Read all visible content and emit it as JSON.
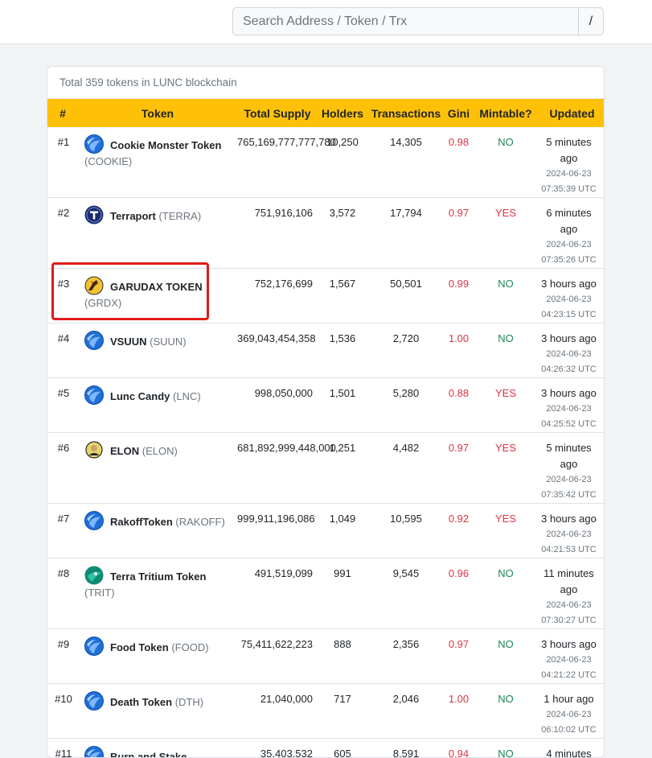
{
  "search": {
    "placeholder": "Search Address / Token / Trx",
    "shortcut_key": "/"
  },
  "card": {
    "title": "Total 359 tokens in LUNC blockchain"
  },
  "table": {
    "headers": [
      "#",
      "Token",
      "Total Supply",
      "Holders",
      "Transactions",
      "Gini",
      "Mintable?",
      "Updated"
    ],
    "rows": [
      {
        "rank": "#1",
        "name": "Cookie Monster Token",
        "symbol": "(COOKIE)",
        "icon": "terra-luna-icon",
        "supply": "765,169,777,777,780",
        "holders": "10,250",
        "transactions": "14,305",
        "gini": "0.98",
        "mintable": "NO",
        "ago": "5 minutes ago",
        "timestamp": "2024-06-23 07:35:39 UTC"
      },
      {
        "rank": "#2",
        "name": "Terraport",
        "symbol": "(TERRA)",
        "icon": "terraport-icon",
        "supply": "751,916,106",
        "holders": "3,572",
        "transactions": "17,794",
        "gini": "0.97",
        "mintable": "YES",
        "ago": "6 minutes ago",
        "timestamp": "2024-06-23 07:35:26 UTC"
      },
      {
        "rank": "#3",
        "name": "GARUDAX TOKEN",
        "symbol": "(GRDX)",
        "icon": "garudax-icon",
        "supply": "752,176,699",
        "holders": "1,567",
        "transactions": "50,501",
        "gini": "0.99",
        "mintable": "NO",
        "ago": "3 hours ago",
        "timestamp": "2024-06-23 04:23:15 UTC"
      },
      {
        "rank": "#4",
        "name": "VSUUN",
        "symbol": "(SUUN)",
        "icon": "terra-luna-icon",
        "supply": "369,043,454,358",
        "holders": "1,536",
        "transactions": "2,720",
        "gini": "1.00",
        "mintable": "NO",
        "ago": "3 hours ago",
        "timestamp": "2024-06-23 04:26:32 UTC"
      },
      {
        "rank": "#5",
        "name": "Lunc Candy",
        "symbol": "(LNC)",
        "icon": "terra-luna-icon",
        "supply": "998,050,000",
        "holders": "1,501",
        "transactions": "5,280",
        "gini": "0.88",
        "mintable": "YES",
        "ago": "3 hours ago",
        "timestamp": "2024-06-23 04:25:52 UTC"
      },
      {
        "rank": "#6",
        "name": "ELON",
        "symbol": "(ELON)",
        "icon": "elon-face-icon",
        "supply": "681,892,999,448,000",
        "holders": "1,251",
        "transactions": "4,482",
        "gini": "0.97",
        "mintable": "YES",
        "ago": "5 minutes ago",
        "timestamp": "2024-06-23 07:35:42 UTC"
      },
      {
        "rank": "#7",
        "name": "RakoffToken",
        "symbol": "(RAKOFF)",
        "icon": "terra-luna-icon",
        "supply": "999,911,196,086",
        "holders": "1,049",
        "transactions": "10,595",
        "gini": "0.92",
        "mintable": "YES",
        "ago": "3 hours ago",
        "timestamp": "2024-06-23 04:21:53 UTC"
      },
      {
        "rank": "#8",
        "name": "Terra Tritium Token",
        "symbol": "(TRIT)",
        "icon": "tritium-icon",
        "supply": "491,519,099",
        "holders": "991",
        "transactions": "9,545",
        "gini": "0.96",
        "mintable": "NO",
        "ago": "11 minutes ago",
        "timestamp": "2024-06-23 07:30:27 UTC"
      },
      {
        "rank": "#9",
        "name": "Food Token",
        "symbol": "(FOOD)",
        "icon": "terra-luna-icon",
        "supply": "75,411,622,223",
        "holders": "888",
        "transactions": "2,356",
        "gini": "0.97",
        "mintable": "NO",
        "ago": "3 hours ago",
        "timestamp": "2024-06-23 04:21:22 UTC"
      },
      {
        "rank": "#10",
        "name": "Death Token",
        "symbol": "(DTH)",
        "icon": "terra-luna-icon",
        "supply": "21,040,000",
        "holders": "717",
        "transactions": "2,046",
        "gini": "1.00",
        "mintable": "NO",
        "ago": "1 hour ago",
        "timestamp": "2024-06-23 06:10:02 UTC"
      },
      {
        "rank": "#11",
        "name": "Burn and Stake",
        "symbol": "",
        "icon": "terra-luna-icon",
        "supply": "35,403,532",
        "holders": "605",
        "transactions": "8,591",
        "gini": "0.94",
        "mintable": "NO",
        "ago": "4 minutes",
        "timestamp": ""
      }
    ]
  },
  "colors": {
    "header_bg": "#ffc107",
    "gini": "#dc3545",
    "mintable_yes": "#dc3545",
    "mintable_no": "#198754",
    "highlight_box": "#e01b1b"
  }
}
